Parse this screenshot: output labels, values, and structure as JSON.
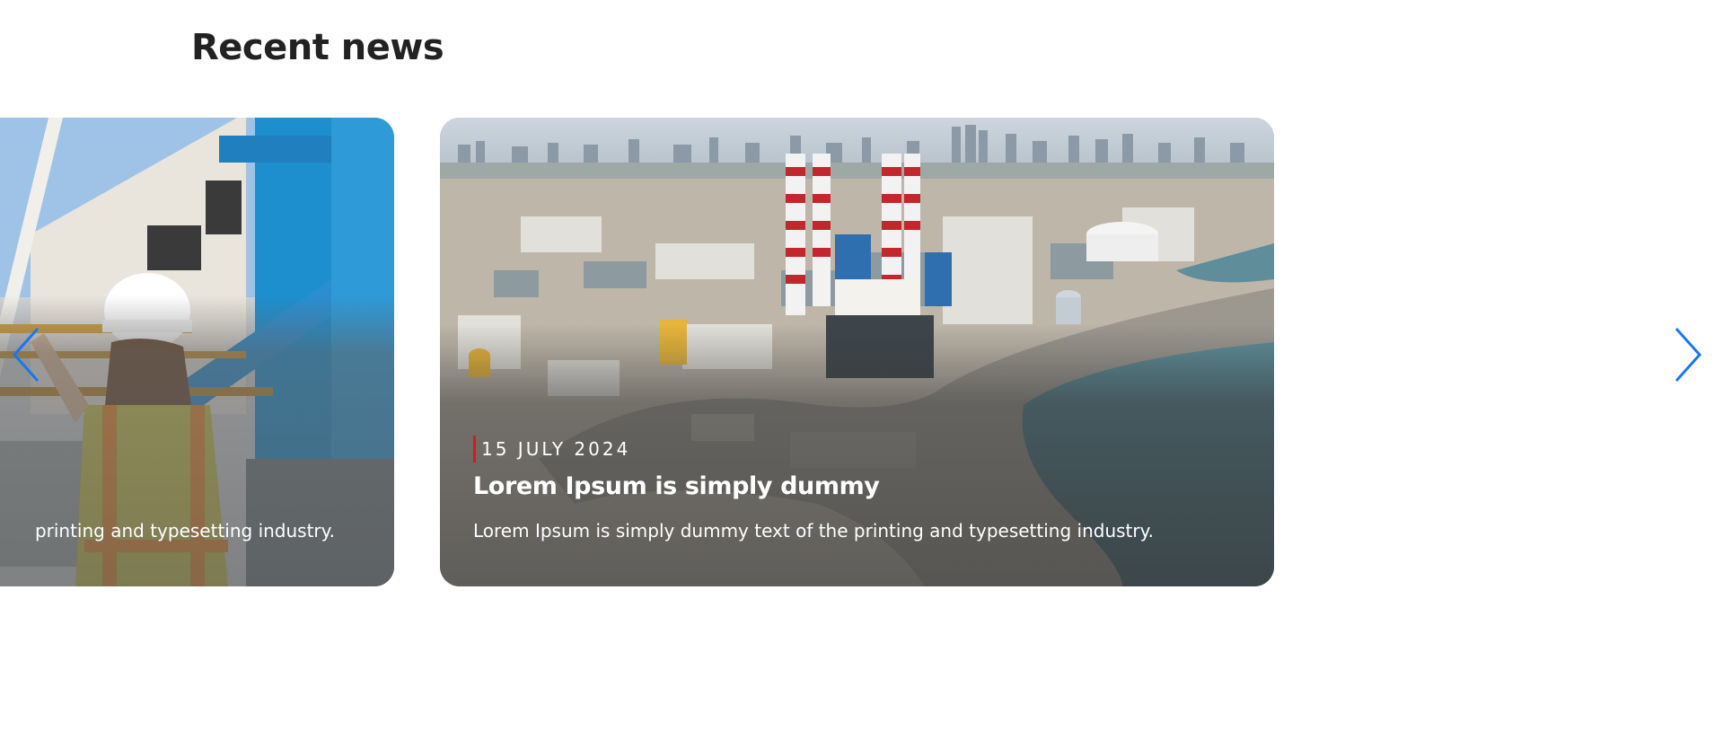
{
  "section": {
    "title": "Recent news"
  },
  "cards": [
    {
      "excerpt_visible": "printing and typesetting industry."
    },
    {
      "date": "15 JULY 2024",
      "title": "Lorem Ipsum is simply dummy",
      "excerpt": "Lorem Ipsum is simply dummy text of the printing and typesetting industry."
    }
  ],
  "navigation": {
    "prev_icon": "chevron-left-icon",
    "next_icon": "chevron-right-icon",
    "arrow_color": "#1877f2"
  },
  "colors": {
    "title": "#222222",
    "date_accent": "#d71920",
    "card_text": "#ffffff"
  }
}
